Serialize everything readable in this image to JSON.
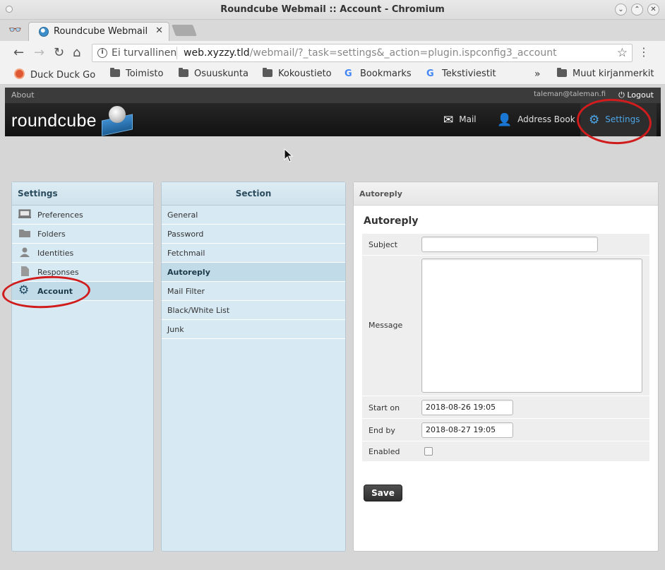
{
  "window": {
    "title": "Roundcube Webmail :: Account - Chromium"
  },
  "browser": {
    "tab_label": "Roundcube Webmail",
    "security_label": "Ei turvallinen",
    "url_host": "web.xyzzy.tld",
    "url_path": "/webmail/?_task=settings&_action=plugin.ispconfig3_account",
    "bookmarks": [
      {
        "label": "Duck Duck Go",
        "icon": "duckduckgo-icon"
      },
      {
        "label": "Toimisto",
        "icon": "folder-icon"
      },
      {
        "label": "Osuuskunta",
        "icon": "folder-icon"
      },
      {
        "label": "Kokoustieto",
        "icon": "folder-icon"
      },
      {
        "label": "Bookmarks",
        "icon": "google-icon"
      },
      {
        "label": "Tekstiviestit",
        "icon": "google-icon"
      }
    ],
    "overflow_label": "»",
    "other_bookmarks": "Muut kirjanmerkit"
  },
  "app": {
    "about": "About",
    "user": "taleman@taleman.fi",
    "logout": "Logout",
    "logo": "roundcube",
    "nav": [
      {
        "label": "Mail",
        "icon": "envelope-icon"
      },
      {
        "label": "Address Book",
        "icon": "person-icon"
      },
      {
        "label": "Settings",
        "icon": "gear-icon",
        "active": true
      }
    ]
  },
  "settings_panel": {
    "title": "Settings",
    "items": [
      {
        "label": "Preferences",
        "icon": "monitor-icon"
      },
      {
        "label": "Folders",
        "icon": "folder-icon"
      },
      {
        "label": "Identities",
        "icon": "person-icon"
      },
      {
        "label": "Responses",
        "icon": "document-icon"
      },
      {
        "label": "Account",
        "icon": "gear-icon",
        "selected": true
      }
    ]
  },
  "section_panel": {
    "title": "Section",
    "items": [
      {
        "label": "General"
      },
      {
        "label": "Password"
      },
      {
        "label": "Fetchmail"
      },
      {
        "label": "Autoreply",
        "selected": true
      },
      {
        "label": "Mail Filter"
      },
      {
        "label": "Black/White List"
      },
      {
        "label": "Junk"
      }
    ]
  },
  "form": {
    "header": "Autoreply",
    "title": "Autoreply",
    "subject_label": "Subject",
    "subject_value": "",
    "message_label": "Message",
    "message_value": "",
    "start_label": "Start on",
    "start_value": "2018-08-26 19:05",
    "end_label": "End by",
    "end_value": "2018-08-27 19:05",
    "enabled_label": "Enabled",
    "enabled": false,
    "save_label": "Save"
  },
  "colors": {
    "annotation_ring": "#d01c1c",
    "active_nav": "#4da6e8",
    "panel_bg": "#d7e9f2"
  }
}
